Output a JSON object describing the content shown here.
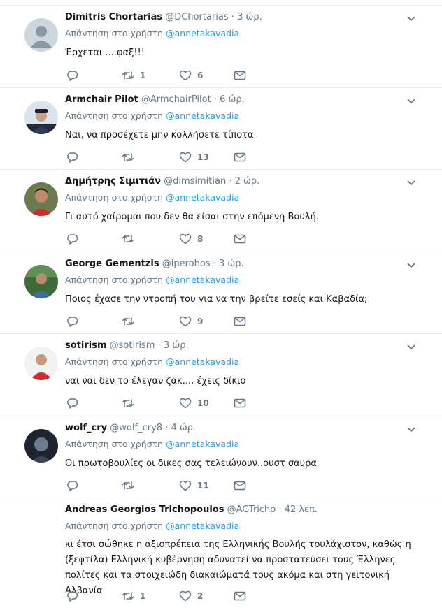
{
  "colors": {
    "link": "#1da1f2",
    "muted": "#657786",
    "text": "#14171a",
    "divider": "#e6ecf0"
  },
  "tweets": [
    {
      "name": "Dimitris Chortarias",
      "handle": "@DChortarias",
      "dot": "·",
      "time": "3 ώρ.",
      "reply_prefix": "Απάντηση στο χρήστη",
      "reply_to": "@annetakavadia",
      "text": "Έρχεται ....φαξ!!!",
      "retweets": "1",
      "likes": "6",
      "avatar": "default-avatar"
    },
    {
      "name": "Armchair Pilot",
      "handle": "@ArmchairPilot",
      "dot": "·",
      "time": "6 ώρ.",
      "reply_prefix": "Απάντηση στο χρήστη",
      "reply_to": "@annetakavadia",
      "text": "Ναι, να προσέχετε μην κολλήσετε τίποτα",
      "retweets": "",
      "likes": "13",
      "avatar": "pilot-photo"
    },
    {
      "name": "Δημήτρης Σιμιτιάν",
      "handle": "@dimsimitian",
      "dot": "·",
      "time": "2 ώρ.",
      "reply_prefix": "Απάντηση στο χρήστη",
      "reply_to": "@annetakavadia",
      "text": "Γι αυτό χαίρομαι που δεν θα είσαι στην επόμενη Βουλή.",
      "retweets": "",
      "likes": "8",
      "avatar": "man-red-shirt-photo"
    },
    {
      "name": "George Gementzis",
      "handle": "@iperohos",
      "dot": "·",
      "time": "3 ώρ.",
      "reply_prefix": "Απάντηση στο χρήστη",
      "reply_to": "@annetakavadia",
      "text": "Ποιος έχασε την ντροπή του για να την βρείτε εσείς και Καβαδία;",
      "retweets": "",
      "likes": "9",
      "avatar": "man-outdoor-photo"
    },
    {
      "name": "sotirism",
      "handle": "@sotirism",
      "dot": "·",
      "time": "3 ώρ.",
      "reply_prefix": "Απάντηση στο χρήστη",
      "reply_to": "@annetakavadia",
      "text": "ναι ναι δεν το έλεγαν ζακ.... έχεις δίκιο",
      "retweets": "",
      "likes": "10",
      "avatar": "man-red-shirt-white-photo"
    },
    {
      "name": "wolf_cry",
      "handle": "@wolf_cry8",
      "dot": "·",
      "time": "4 ώρ.",
      "reply_prefix": "Απάντηση στο χρήστη",
      "reply_to": "@annetakavadia",
      "text": "Οι πρωτοβουλίες οι δικες σας τελειώνουν..ουστ σαυρα",
      "retweets": "",
      "likes": "11",
      "avatar": "dark-photo"
    },
    {
      "name": "Andreas Georgios Trichopoulos",
      "handle": "@AGTricho",
      "dot": "·",
      "time": "42 λεπ.",
      "reply_prefix": "Απάντηση στο χρήστη",
      "reply_to": "@annetakavadia",
      "text": "κι έτσι σώθηκε η αξιοπρέπεια της Ελληνικής Βουλής τουλάχιστον, καθώς η (ξεφτίλα) Ελληνική κυβέρνηση αδυνατεί να προστατεύσει τους Έλληνες πολίτες και τα στοιχειώδη διακαιώματά τους ακόμα και στη γειτονική Αλβανία",
      "retweets": "1",
      "likes": "2",
      "avatar": "none"
    }
  ]
}
